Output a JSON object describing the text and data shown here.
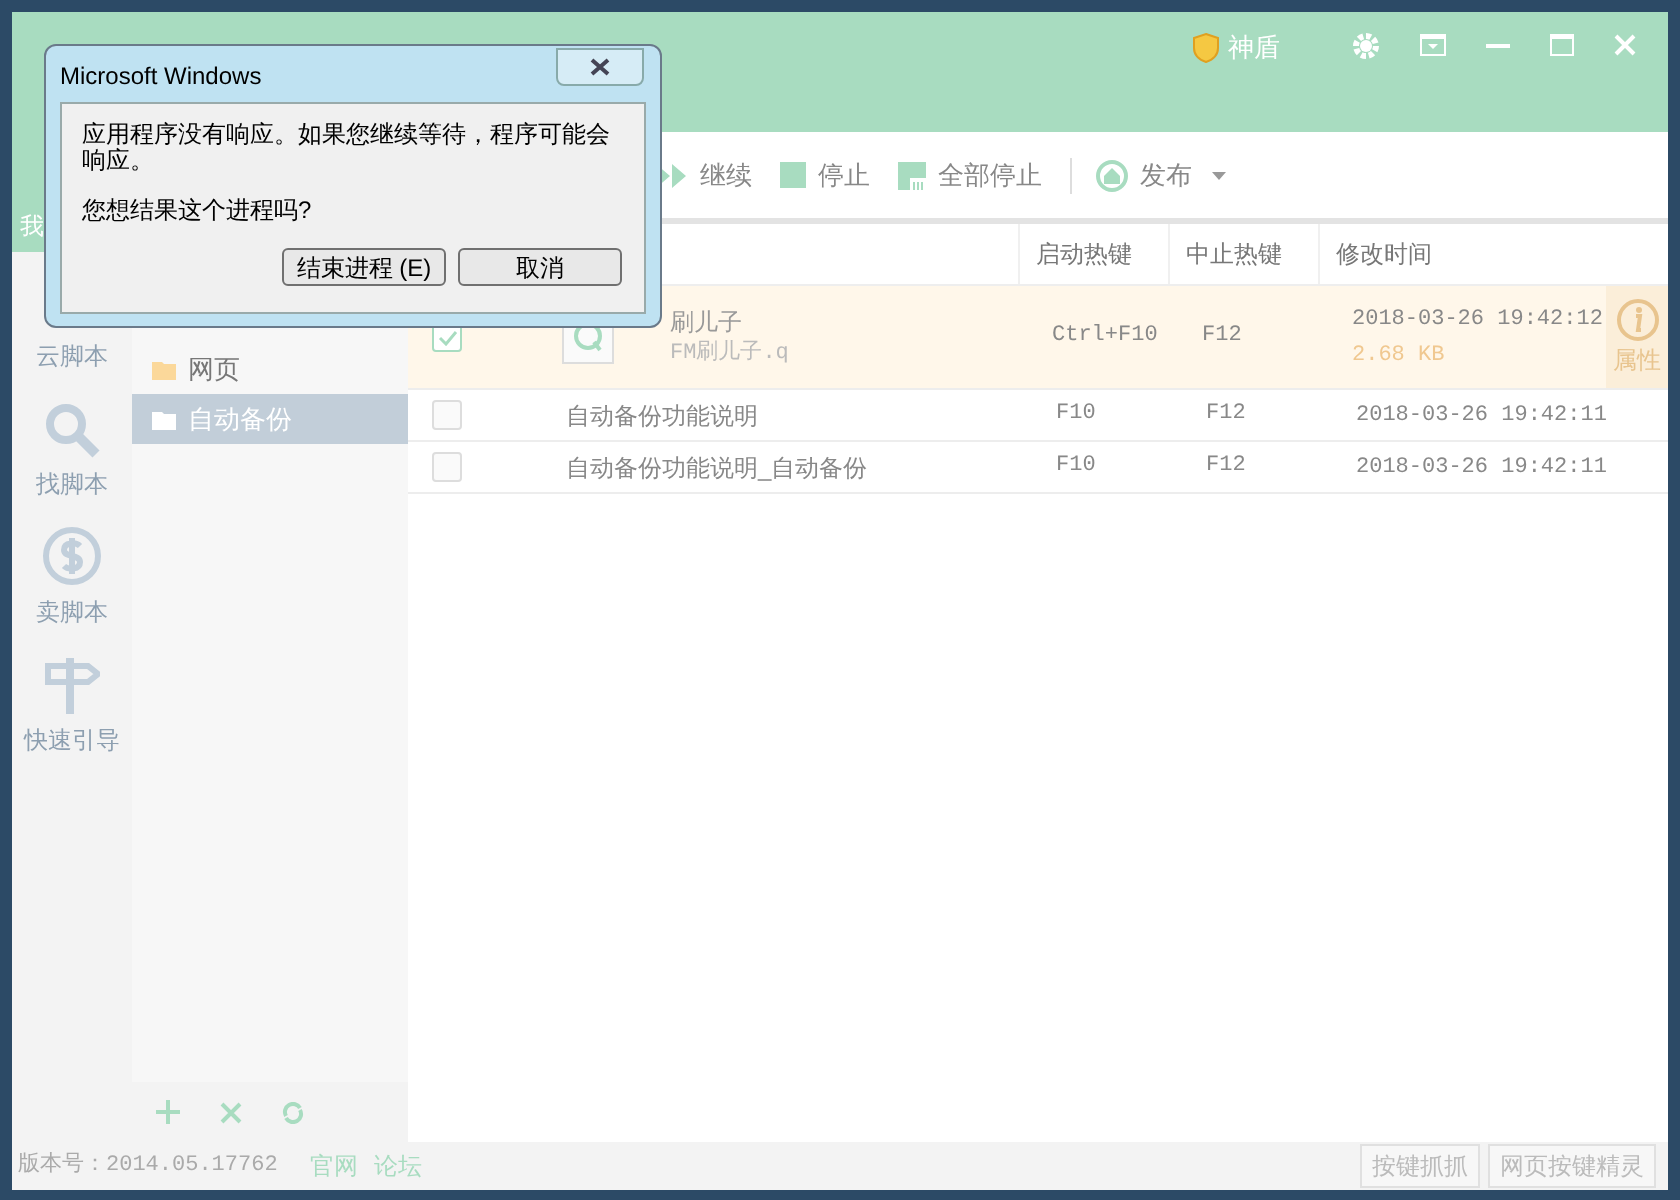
{
  "title_bar": {
    "shield_label": "神盾"
  },
  "toolbar": [
    {
      "kind": "resume",
      "label": "继续"
    },
    {
      "kind": "stop",
      "label": "停止"
    },
    {
      "kind": "stop_all",
      "label": "全部停止"
    },
    {
      "kind": "publish",
      "label": "发布"
    }
  ],
  "left_nav": [
    {
      "label": "我",
      "selected": true,
      "kind": "mine"
    },
    {
      "label": "云脚本",
      "selected": false,
      "kind": "cloud"
    },
    {
      "label": "找脚本",
      "selected": false,
      "kind": "search"
    },
    {
      "label": "卖脚本",
      "selected": false,
      "kind": "sell"
    },
    {
      "label": "快速引导",
      "selected": false,
      "kind": "guide"
    }
  ],
  "folders": [
    {
      "label": "网页",
      "selected": false
    },
    {
      "label": "自动备份",
      "selected": true
    }
  ],
  "table": {
    "columns": [
      "启动热键",
      "中止热键",
      "修改时间"
    ],
    "rows": [
      {
        "name": "刷儿子",
        "file": "FM刷儿子.q",
        "start_key": "Ctrl+F10",
        "stop_key": "F12",
        "modified": "2018-03-26 19:42:12",
        "size": "2.68 KB",
        "checked": true,
        "selected": true,
        "action": "属性"
      },
      {
        "name": "自动备份功能说明",
        "start_key": "F10",
        "stop_key": "F12",
        "modified": "2018-03-26 19:42:11",
        "checked": false,
        "selected": false
      },
      {
        "name": "自动备份功能说明_自动备份",
        "start_key": "F10",
        "stop_key": "F12",
        "modified": "2018-03-26 19:42:11",
        "checked": false,
        "selected": false
      }
    ]
  },
  "footer": {
    "version": "版本号：2014.05.17762",
    "links": [
      "官网",
      "论坛"
    ],
    "buttons": [
      "按键抓抓",
      "网页按键精灵"
    ]
  },
  "dialog": {
    "title": "Microsoft Windows",
    "message": "应用程序没有响应。如果您继续等待，程序可能会响应。",
    "question": "您想结果这个进程吗?",
    "buttons": [
      "结束进程 (E)",
      "取消"
    ]
  }
}
